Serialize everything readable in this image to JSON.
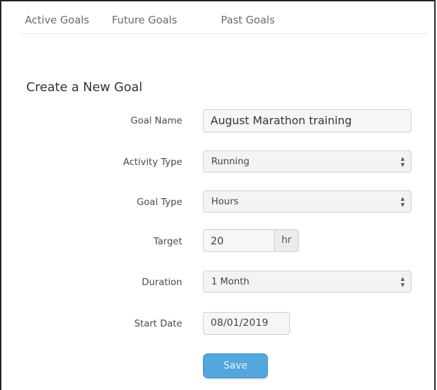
{
  "tabs": {
    "active": "Active Goals",
    "future": "Future Goals",
    "past": "Past Goals"
  },
  "form": {
    "title": "Create a New Goal",
    "goal_name": {
      "label": "Goal Name",
      "value": "August Marathon training"
    },
    "activity_type": {
      "label": "Activity Type",
      "value": "Running"
    },
    "goal_type": {
      "label": "Goal Type",
      "value": "Hours"
    },
    "target": {
      "label": "Target",
      "value": "20",
      "unit": "hr"
    },
    "duration": {
      "label": "Duration",
      "value": "1 Month"
    },
    "start_date": {
      "label": "Start Date",
      "value": "08/01/2019"
    },
    "save_label": "Save"
  },
  "icons": {
    "select_arrows": "up-down-chevron-icon"
  },
  "colors": {
    "save_button": "#54a7dd",
    "page_background": "#ffffff"
  }
}
